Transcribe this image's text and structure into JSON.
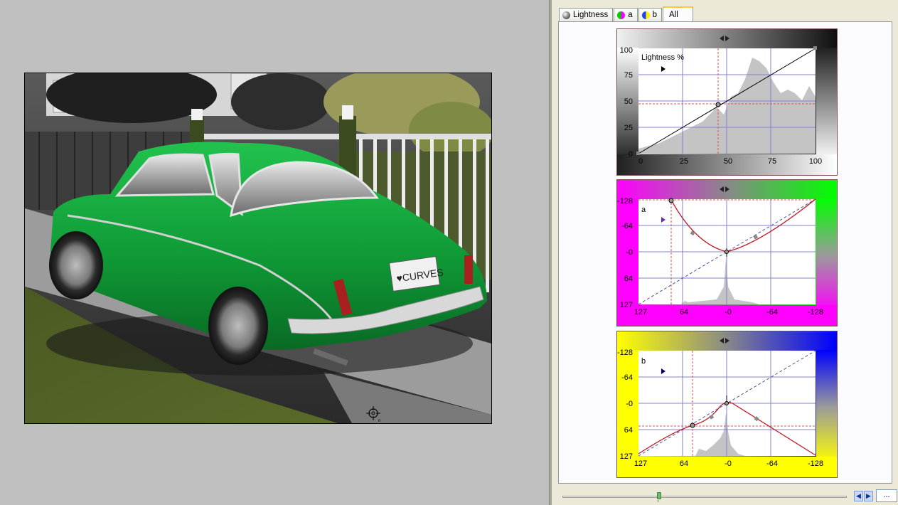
{
  "tabs": [
    {
      "label": "Lightness",
      "icon": "lightness-ball-icon"
    },
    {
      "label": "a",
      "icon": "a-channel-ball-icon"
    },
    {
      "label": "b",
      "icon": "b-channel-ball-icon"
    },
    {
      "label": "All",
      "icon": ""
    }
  ],
  "active_tab": "All",
  "lightness_curve": {
    "channel_label": "Lightness %",
    "y_ticks": [
      "100",
      "75",
      "50",
      "25",
      "0"
    ],
    "x_ticks": [
      "0",
      "25",
      "50",
      "75",
      "100"
    ],
    "curve_points": [
      [
        0,
        0
      ],
      [
        45,
        47
      ],
      [
        100,
        100
      ]
    ],
    "crosshair": {
      "x": 45,
      "y": 47
    }
  },
  "a_curve": {
    "channel_label": "a",
    "y_ticks": [
      "-128",
      "-64",
      "-0",
      "64",
      "127"
    ],
    "x_ticks": [
      "127",
      "64",
      "-0",
      "-64",
      "-128"
    ],
    "colors": {
      "top_left": "#ff00ff",
      "top_right": "#00ff00"
    }
  },
  "b_curve": {
    "channel_label": "b",
    "y_ticks": [
      "-128",
      "-64",
      "-0",
      "64",
      "127"
    ],
    "x_ticks": [
      "127",
      "64",
      "-0",
      "-64",
      "-128"
    ],
    "colors": {
      "top_left": "#ffff00",
      "top_right": "#0000ff"
    }
  },
  "bottom_bar": {
    "slider_value": 0.34,
    "more_label": "..."
  },
  "colors": {
    "panel_bg": "#ece9d8",
    "canvas_bg": "#c0c0c0",
    "curve_red": "#c0202a",
    "grid_blue": "#8080d0",
    "car_green": "#11a03a"
  }
}
